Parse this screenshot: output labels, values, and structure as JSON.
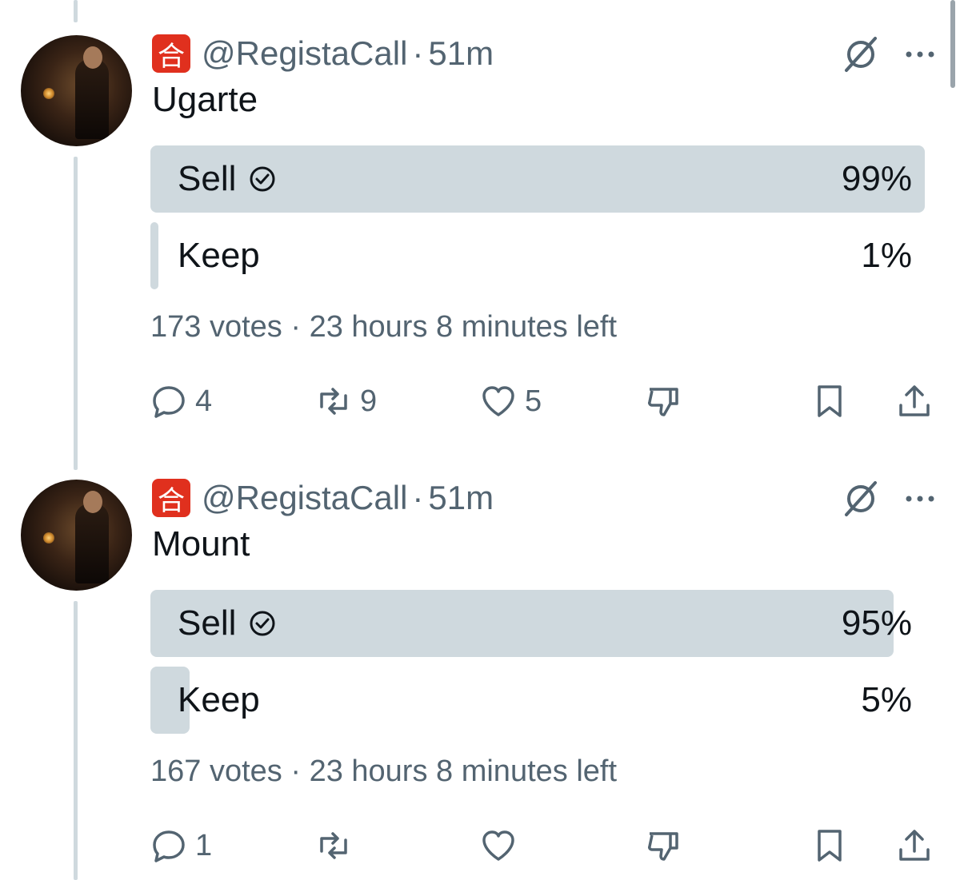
{
  "tweets": [
    {
      "handle": "@RegistaCall",
      "separator": "·",
      "time": "51m",
      "badge_glyph": "合",
      "text": "Ugarte",
      "poll": {
        "options": [
          {
            "label": "Sell",
            "percent": "99%",
            "fraction": 0.99,
            "winner": true
          },
          {
            "label": "Keep",
            "percent": "1%",
            "fraction": 0.01,
            "winner": false
          }
        ],
        "votes": "173 votes",
        "time_left": "23 hours 8 minutes left"
      },
      "actions": {
        "replies": "4",
        "reposts": "9",
        "likes": "5"
      }
    },
    {
      "handle": "@RegistaCall",
      "separator": "·",
      "time": "51m",
      "badge_glyph": "合",
      "text": "Mount",
      "poll": {
        "options": [
          {
            "label": "Sell",
            "percent": "95%",
            "fraction": 0.95,
            "winner": true
          },
          {
            "label": "Keep",
            "percent": "5%",
            "fraction": 0.05,
            "winner": false
          }
        ],
        "votes": "167 votes",
        "time_left": "23 hours 8 minutes left"
      },
      "actions": {
        "replies": "1",
        "reposts": "",
        "likes": ""
      }
    }
  ],
  "colors": {
    "accent_badge": "#e0301e",
    "poll_bar": "#cfd9de",
    "secondary_text": "#536471"
  },
  "icons": [
    "reply-icon",
    "repost-icon",
    "like-icon",
    "dislike-icon",
    "bookmark-icon",
    "share-icon",
    "grok-icon",
    "more-icon",
    "check-circle-icon"
  ]
}
